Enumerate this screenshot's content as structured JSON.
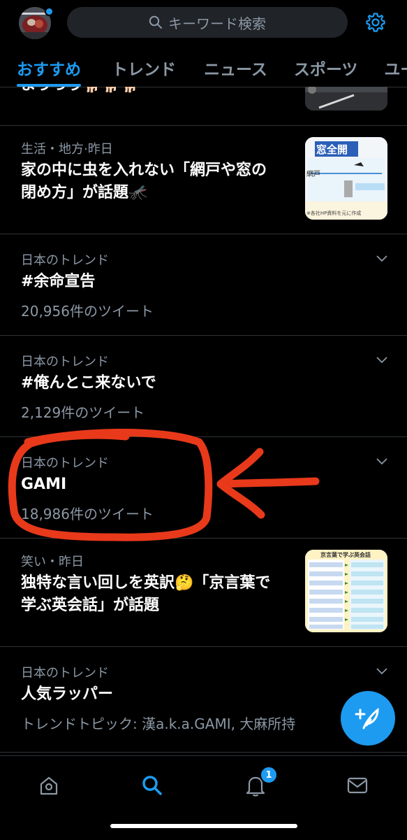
{
  "header": {
    "search_placeholder": "キーワード検索",
    "tabs": [
      "おすすめ",
      "トレンド",
      "ニュース",
      "スポーツ",
      "ユー"
    ]
  },
  "feed": [
    {
      "title": "ようっう🐕🐕🐕"
    },
    {
      "meta": "生活・地方·昨日",
      "title_line1": "家の中に虫を入れない「網戸や窓の",
      "title_line2": "閉め方」が話題🦟",
      "thumb": {
        "heading": "窓全開",
        "label_left": "網戸",
        "caption": "※各社HP資料を元に作成"
      }
    },
    {
      "meta": "日本のトレンド",
      "title": "#余命宣告",
      "count": "20,956件のツイート"
    },
    {
      "meta": "日本のトレンド",
      "title": "#俺んとこ来ないで",
      "count": "2,129件のツイート"
    },
    {
      "meta": "日本のトレンド",
      "title": "GAMI",
      "count": "18,986件のツイート"
    },
    {
      "meta": "笑い・昨日",
      "title_line1": "独特な言い回しを英訳🤔「京言葉で",
      "title_line2": "学ぶ英会話」が話題",
      "thumb": {
        "heading": "京言葉で学ぶ英会話"
      }
    },
    {
      "meta": "日本のトレンド",
      "title": "人気ラッパー",
      "count": "トレンドトピック: 漢a.k.a.GAMI, 大麻所持"
    }
  ],
  "notifications": {
    "badge": "1"
  },
  "colors": {
    "accent": "#1d9bf0",
    "annotation": "#e8391b",
    "background": "#000000"
  }
}
